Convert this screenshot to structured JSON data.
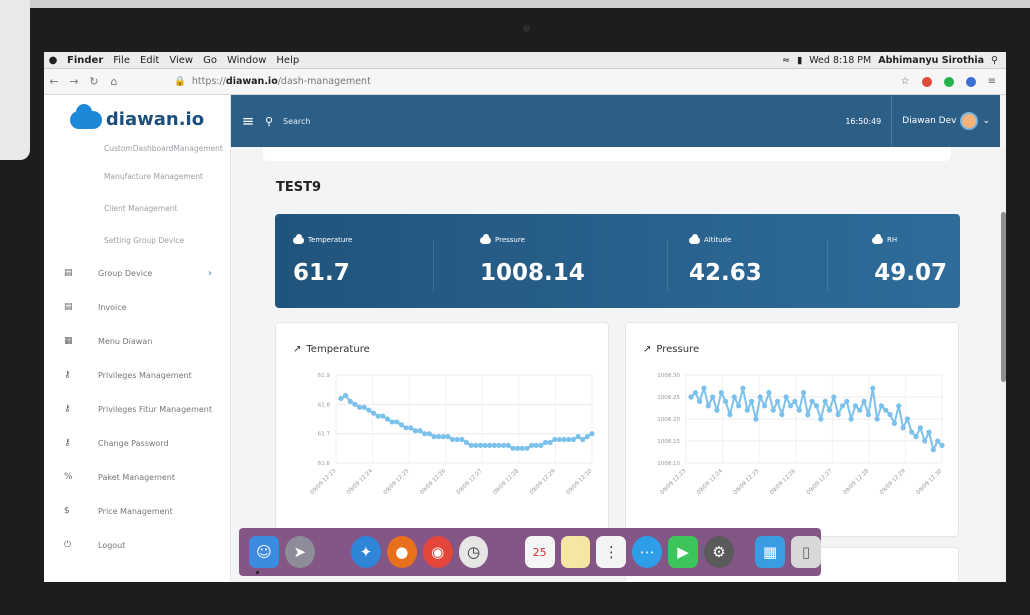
{
  "menubar": {
    "app": "Finder",
    "items": [
      "File",
      "Edit",
      "View",
      "Go",
      "Window",
      "Help"
    ],
    "clock": "Wed 8:18 PM",
    "user": "Abhimanyu Sirothia"
  },
  "browser": {
    "url_prefix": "https://",
    "url_domain": "diawan.io",
    "url_path": "/dash-management"
  },
  "sidebar": {
    "logo": "diawan.io",
    "sub_items": [
      "CustomDashboardManagement",
      "Manufacture Management",
      "Client Management",
      "Setting Group Device"
    ],
    "items": [
      {
        "label": "Group Device",
        "icon": "devices-icon"
      },
      {
        "label": "Invoice",
        "icon": "invoice-icon"
      },
      {
        "label": "Menu Diawan",
        "icon": "menu-icon"
      },
      {
        "label": "Privileges Management",
        "icon": "key-icon"
      },
      {
        "label": "Privileges Fitur Management",
        "icon": "key-icon"
      },
      {
        "label": "Change Password",
        "icon": "key-icon"
      },
      {
        "label": "Paket Management",
        "icon": "percent-icon"
      },
      {
        "label": "Price Management",
        "icon": "dollar-icon"
      },
      {
        "label": "Logout",
        "icon": "power-icon"
      }
    ]
  },
  "header": {
    "search_label": "Search",
    "clock": "16:50:49",
    "user_name": "Diawan Dev"
  },
  "main": {
    "title": "TEST9",
    "stats": [
      {
        "label": "Temperature",
        "value": "61.7"
      },
      {
        "label": "Pressure",
        "value": "1008.14"
      },
      {
        "label": "Altitude",
        "value": "42.63"
      },
      {
        "label": "RH",
        "value": "49.07"
      }
    ]
  },
  "chart_data": [
    {
      "type": "line",
      "title": "Temperature",
      "color": "#7cc1ec",
      "ylim": [
        61.6,
        61.9
      ],
      "yticks": [
        "61.9",
        "61.8",
        "61.7",
        "61.6"
      ],
      "xticks": [
        "09/09 12:23",
        "09/09 12:24",
        "09/09 12:25",
        "09/09 12:26",
        "09/09 12:27",
        "09/09 12:28",
        "09/09 12:29",
        "09/09 12:30"
      ],
      "values": [
        61.82,
        61.83,
        61.81,
        61.8,
        61.79,
        61.79,
        61.78,
        61.77,
        61.76,
        61.76,
        61.75,
        61.74,
        61.74,
        61.73,
        61.72,
        61.72,
        61.71,
        61.71,
        61.7,
        61.7,
        61.69,
        61.69,
        61.69,
        61.69,
        61.68,
        61.68,
        61.68,
        61.67,
        61.66,
        61.66,
        61.66,
        61.66,
        61.66,
        61.66,
        61.66,
        61.66,
        61.66,
        61.65,
        61.65,
        61.65,
        61.65,
        61.66,
        61.66,
        61.66,
        61.67,
        61.67,
        61.68,
        61.68,
        61.68,
        61.68,
        61.68,
        61.69,
        61.68,
        61.69,
        61.7
      ]
    },
    {
      "type": "line",
      "title": "Pressure",
      "color": "#7cc1ec",
      "ylim": [
        1008.1,
        1008.3
      ],
      "yticks": [
        "1008.30",
        "1008.25",
        "1008.20",
        "1008.15",
        "1008.10"
      ],
      "xticks": [
        "09/09 12:23",
        "09/09 12:24",
        "09/09 12:25",
        "09/09 12:26",
        "09/09 12:27",
        "09/09 12:28",
        "09/09 12:29",
        "09/09 12:30"
      ],
      "values": [
        1008.25,
        1008.26,
        1008.24,
        1008.27,
        1008.23,
        1008.25,
        1008.22,
        1008.26,
        1008.24,
        1008.21,
        1008.25,
        1008.23,
        1008.27,
        1008.22,
        1008.24,
        1008.2,
        1008.25,
        1008.23,
        1008.26,
        1008.22,
        1008.24,
        1008.21,
        1008.25,
        1008.23,
        1008.24,
        1008.22,
        1008.26,
        1008.21,
        1008.24,
        1008.23,
        1008.2,
        1008.24,
        1008.22,
        1008.25,
        1008.21,
        1008.23,
        1008.24,
        1008.2,
        1008.23,
        1008.22,
        1008.24,
        1008.21,
        1008.27,
        1008.2,
        1008.23,
        1008.22,
        1008.21,
        1008.19,
        1008.23,
        1008.18,
        1008.2,
        1008.17,
        1008.16,
        1008.18,
        1008.15,
        1008.17,
        1008.13,
        1008.15,
        1008.14
      ]
    }
  ]
}
